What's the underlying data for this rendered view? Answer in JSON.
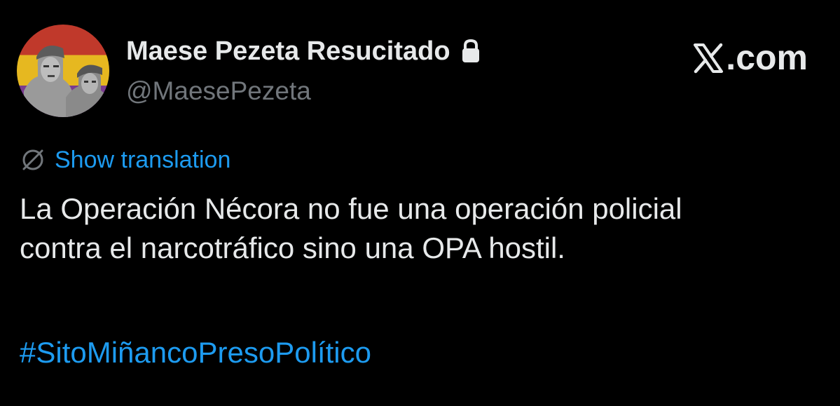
{
  "author": {
    "display_name": "Maese Pezeta Resucitado",
    "handle": "@MaesePezeta",
    "protected_icon": "lock-icon",
    "avatar_icon": "avatar-photo"
  },
  "brand": {
    "site": ".com",
    "logo_icon": "x-logo-icon"
  },
  "translation": {
    "icon": "globe-slash-icon",
    "label": "Show translation"
  },
  "tweet": {
    "lines": [
      "La Operación Nécora no fue una operación policial",
      "contra el narcotráfico sino una OPA hostil."
    ],
    "hashtag": "#SitoMiñancoPresoPolítico"
  },
  "colors": {
    "background": "#000000",
    "text": "#e7e9ea",
    "secondary": "#71767b",
    "link": "#1d9bf0"
  }
}
